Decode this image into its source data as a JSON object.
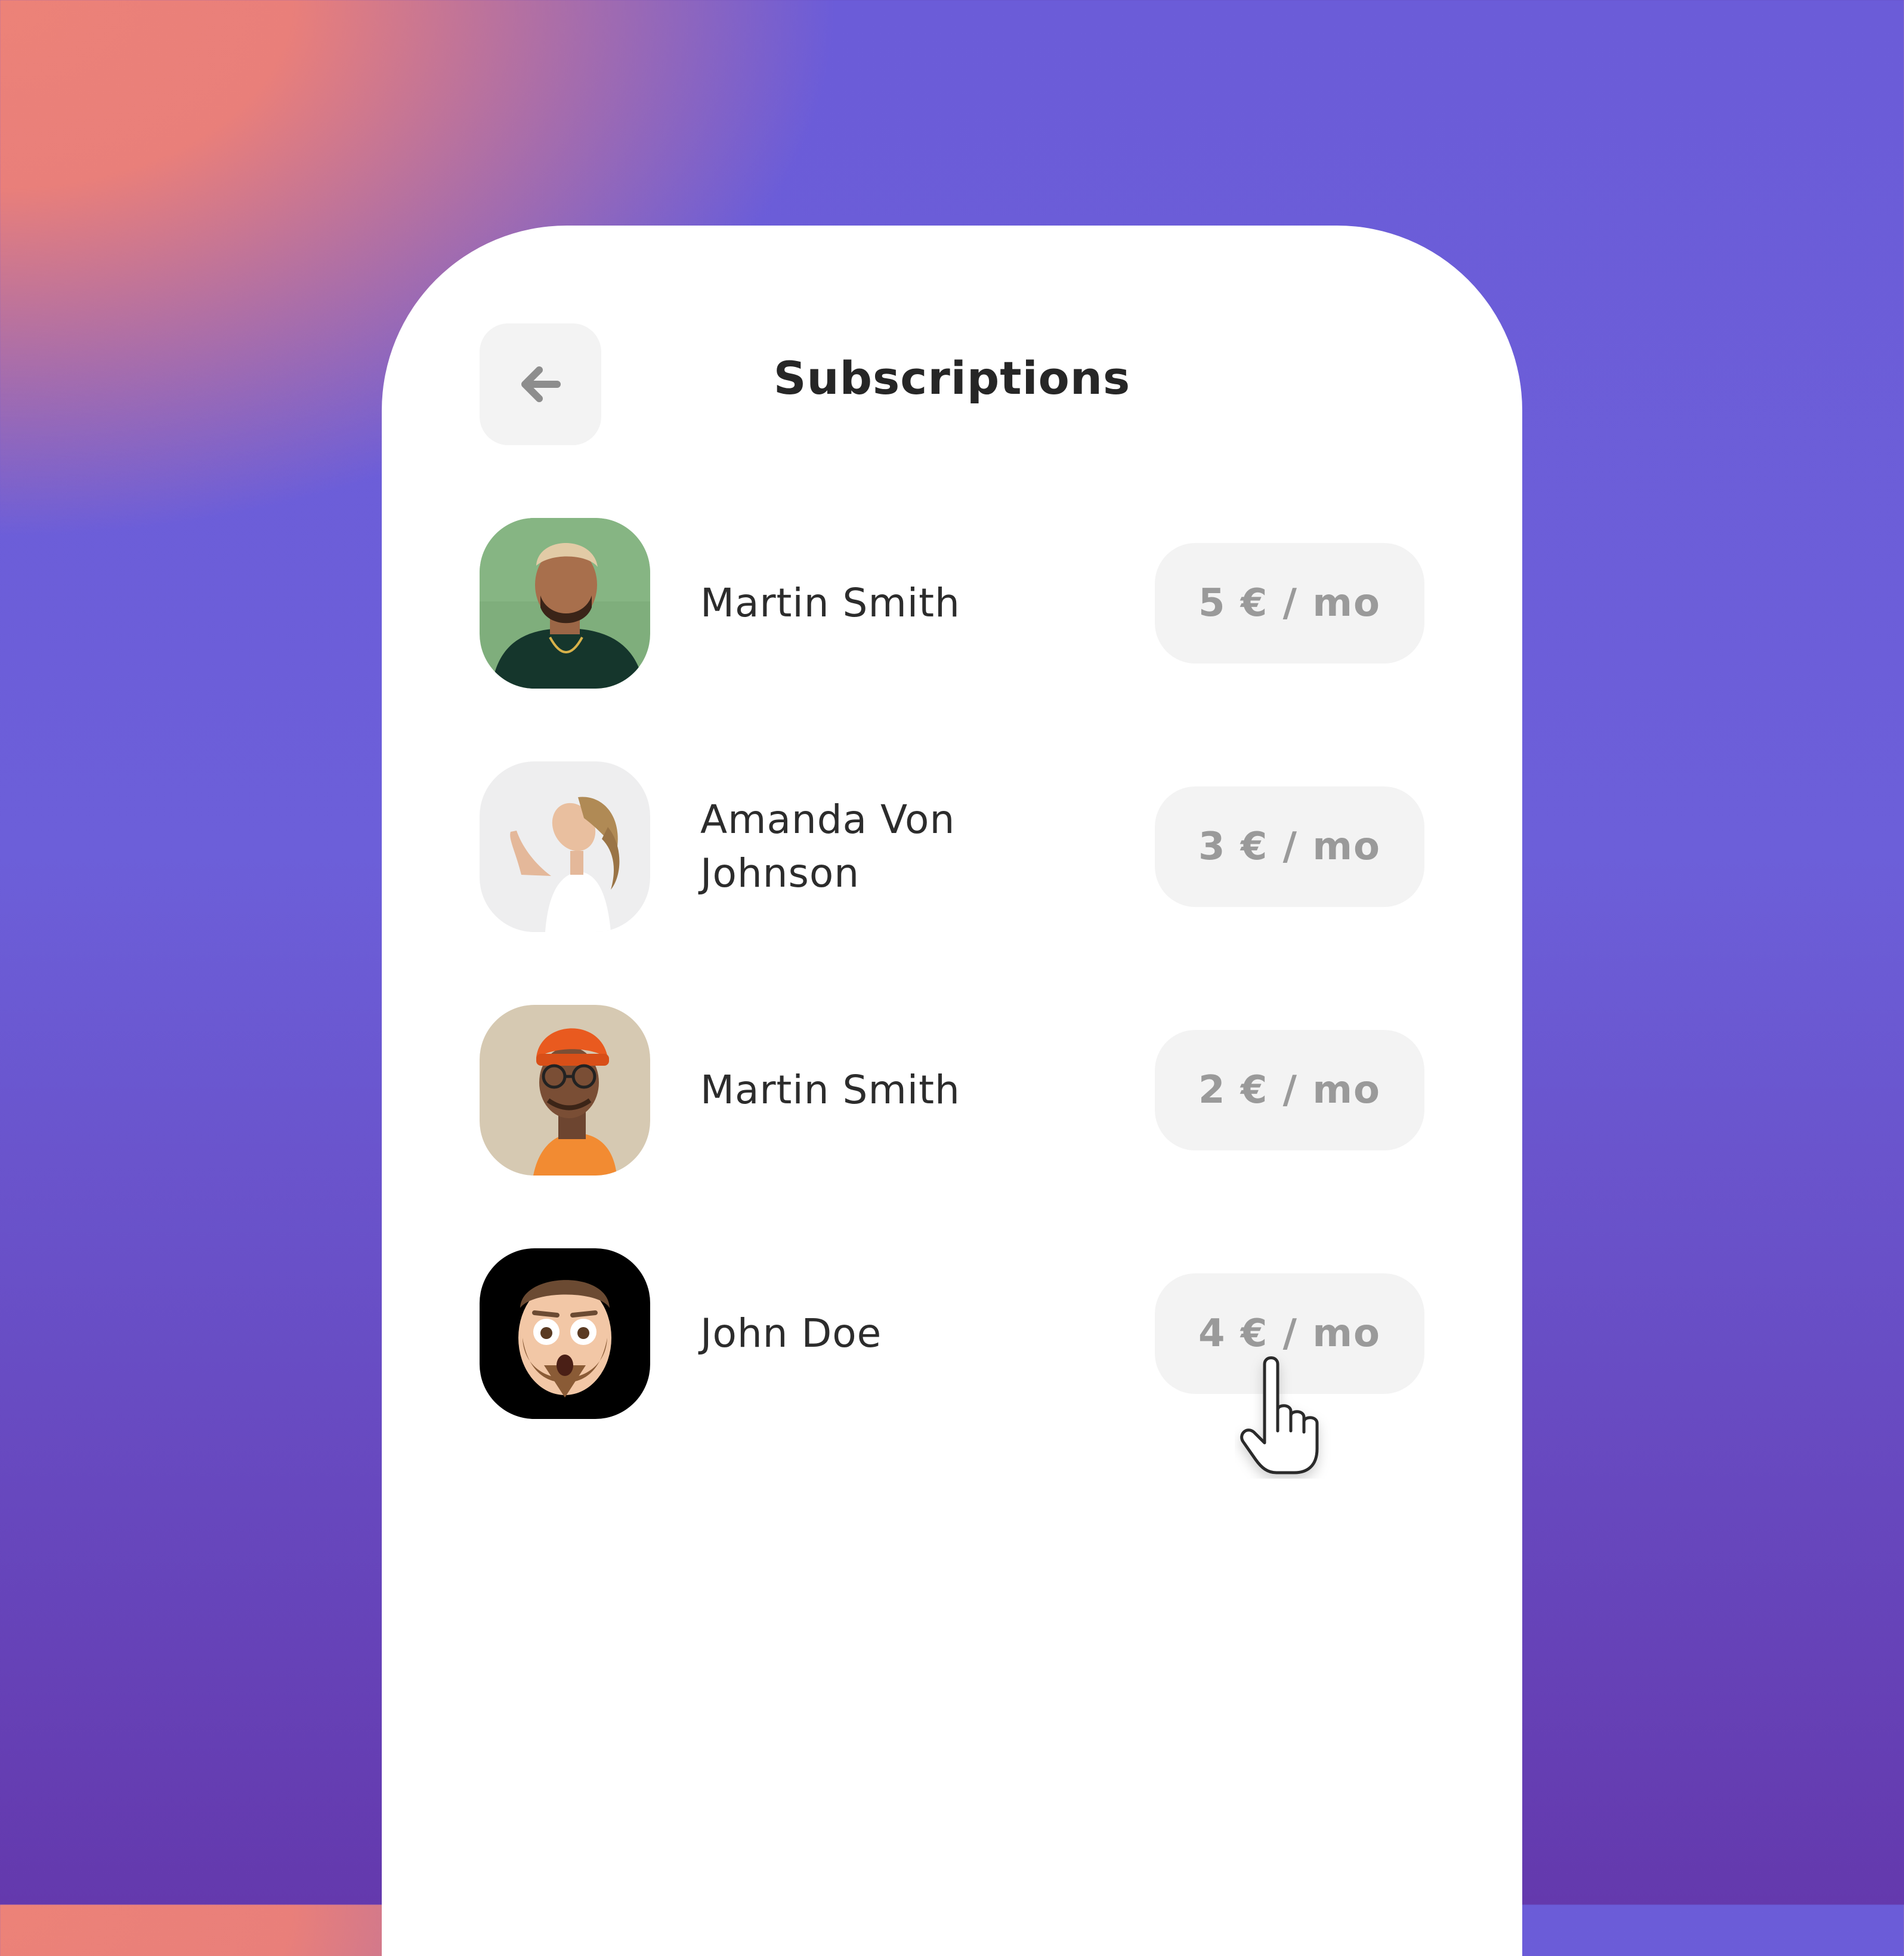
{
  "header": {
    "title": "Subscriptions",
    "back_icon": "arrow-left-icon"
  },
  "subscriptions": [
    {
      "name": "Martin Smith",
      "price": "5 € / mo",
      "avatar": "photo-man-green-background"
    },
    {
      "name": "Amanda Von Johnson",
      "price": "3 € / mo",
      "avatar": "photo-woman-white-background"
    },
    {
      "name": "Martin Smith",
      "price": "2 € / mo",
      "avatar": "photo-man-orange-beanie"
    },
    {
      "name": "John Doe",
      "price": "4 € / mo",
      "avatar": "memoji-bearded-man"
    }
  ],
  "colors": {
    "background_coral": "#ec8278",
    "background_purple": "#6b5cd8",
    "card": "#ffffff",
    "button_bg": "#f3f3f3",
    "title_text": "#262626",
    "price_text": "#9a9a9a"
  },
  "cursor_icon": "hand-pointer-icon"
}
